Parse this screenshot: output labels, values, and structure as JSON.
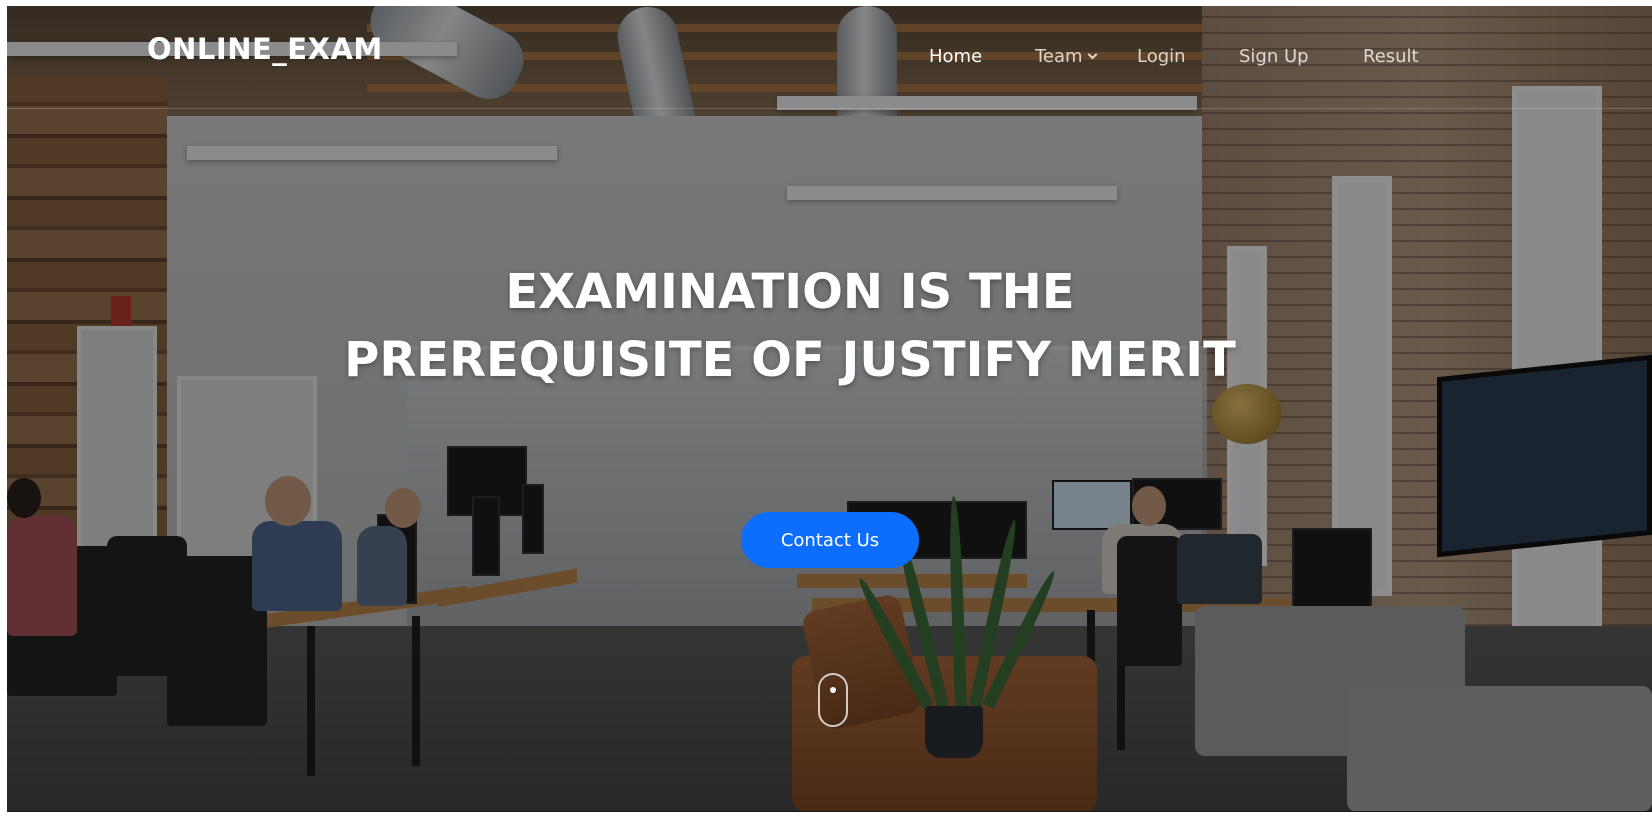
{
  "header": {
    "logo": "ONLINE_EXAM",
    "nav": [
      {
        "label": "Home",
        "active": true
      },
      {
        "label": "Team",
        "dropdown": true
      },
      {
        "label": "Login"
      },
      {
        "label": "Sign Up"
      },
      {
        "label": "Result"
      }
    ]
  },
  "hero": {
    "title": "EXAMINATION IS THE PREREQUISITE OF JUSTIFY MERIT",
    "cta_label": "Contact Us"
  },
  "colors": {
    "accent": "#0d6efd",
    "text": "#ffffff"
  }
}
